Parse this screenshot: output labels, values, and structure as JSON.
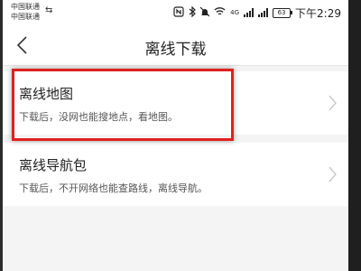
{
  "status_bar": {
    "carrier_1": "中国联通",
    "carrier_2": "中国联通",
    "network_badge": "4G",
    "battery": "63",
    "time": "下午2:29"
  },
  "nav": {
    "title": "离线下载",
    "back_icon": "chevron-left-icon"
  },
  "items": [
    {
      "title": "离线地图",
      "desc": "下载后，没网也能搜地点，看地图。"
    },
    {
      "title": "离线导航包",
      "desc": "下载后，不开网络也能查路线，离线导航。"
    }
  ],
  "colors": {
    "highlight": "#e02020",
    "background": "#f4f4f4",
    "surface": "#ffffff"
  }
}
